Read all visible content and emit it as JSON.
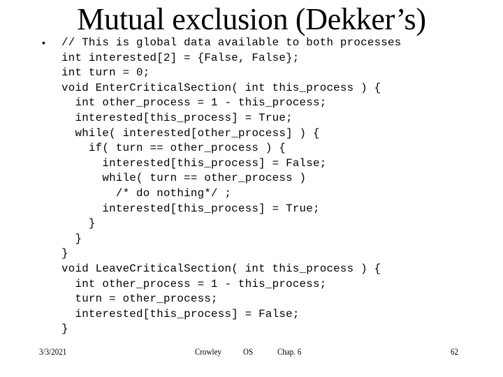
{
  "slide": {
    "title": "Mutual exclusion (Dekker’s)",
    "bullet_glyph": "•",
    "code_lines": [
      {
        "indent": 0,
        "text": "// This is global data available to both processes"
      },
      {
        "indent": 0,
        "text": "int interested[2] = {False, False};"
      },
      {
        "indent": 0,
        "text": "int turn = 0;"
      },
      {
        "indent": 0,
        "text": "void EnterCriticalSection( int this_process ) {"
      },
      {
        "indent": 1,
        "text": "int other_process = 1 - this_process;"
      },
      {
        "indent": 1,
        "text": "interested[this_process] = True;"
      },
      {
        "indent": 1,
        "text": "while( interested[other_process] ) {"
      },
      {
        "indent": 2,
        "text": "if( turn == other_process ) {"
      },
      {
        "indent": 3,
        "text": "interested[this_process] = False;"
      },
      {
        "indent": 3,
        "text": "while( turn == other_process )"
      },
      {
        "indent": 4,
        "text": "/* do nothing*/ ;"
      },
      {
        "indent": 3,
        "text": "interested[this_process] = True;"
      },
      {
        "indent": 2,
        "text": "}"
      },
      {
        "indent": 1,
        "text": "}"
      },
      {
        "indent": 0,
        "text": "}"
      },
      {
        "indent": 0,
        "text": "void LeaveCriticalSection( int this_process ) {"
      },
      {
        "indent": 1,
        "text": "int other_process = 1 - this_process;"
      },
      {
        "indent": 1,
        "text": "turn = other_process;"
      },
      {
        "indent": 1,
        "text": "interested[this_process] = False;"
      },
      {
        "indent": 0,
        "text": "}"
      }
    ]
  },
  "footer": {
    "date": "3/3/2021",
    "author": "Crowley",
    "course": "OS",
    "chapter": "Chap. 6",
    "page_number": "62"
  }
}
